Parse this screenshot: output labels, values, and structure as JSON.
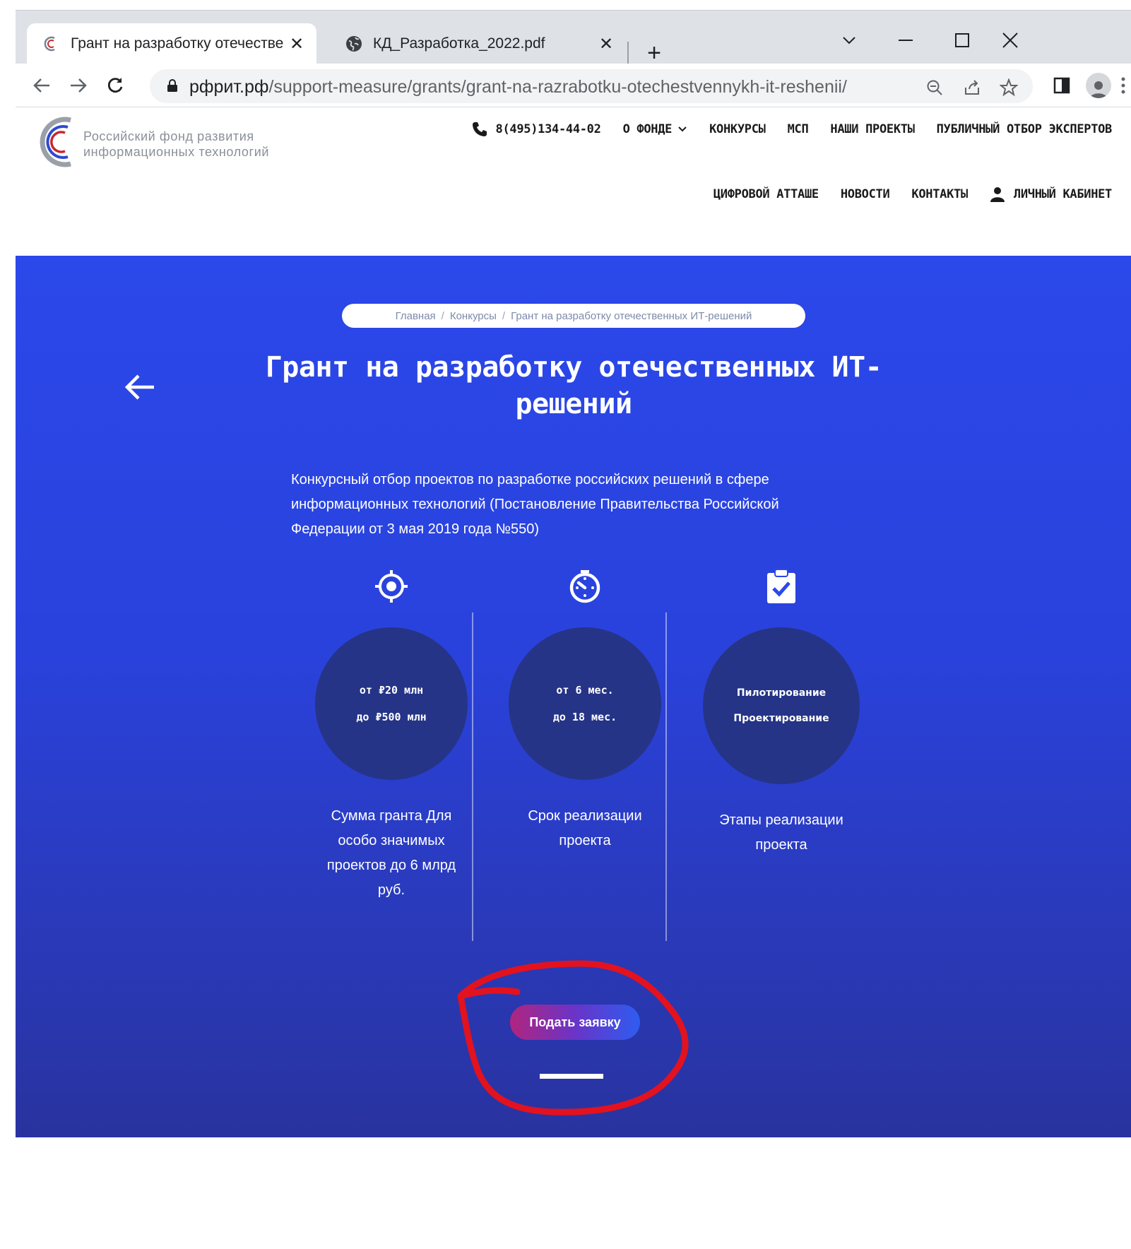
{
  "browser": {
    "tabs": [
      {
        "title": "Грант на разработку отечественных ИТ-решений",
        "active": true
      },
      {
        "title": "КД_Разработка_2022.pdf",
        "active": false
      }
    ],
    "url_host": "рфрит.рф",
    "url_path": "/support-measure/grants/grant-na-razrabotku-otechestvennykh-it-reshenii/"
  },
  "site": {
    "logo_line1": "Российский фонд развития",
    "logo_line2": "информационных технологий",
    "phone": "8(495)134-44-02",
    "nav_row1": [
      "О ФОНДЕ",
      "КОНКУРСЫ",
      "МСП",
      "НАШИ ПРОЕКТЫ",
      "ПУБЛИЧНЫЙ ОТБОР ЭКСПЕРТОВ"
    ],
    "nav_row2": [
      "ЦИФРОВОЙ АТТАШЕ",
      "НОВОСТИ",
      "КОНТАКТЫ",
      "ЛИЧНЫЙ КАБИНЕТ"
    ]
  },
  "hero": {
    "breadcrumb": [
      "Главная",
      "Конкурсы",
      "Грант на разработку отечественных ИТ-решений"
    ],
    "breadcrumb_sep": "/",
    "title_line1": "Грант на разработку отечественных ИТ-",
    "title_line2": "решений",
    "description": "Конкурсный отбор проектов по разработке российских решений в сфере информационных технологий (Постановление Правительства Российской Федерации от 3 мая 2019 года №550)",
    "stats": [
      {
        "icon": "target-icon",
        "line1": "от ₽20 млн",
        "line2": "до ₽500 млн",
        "caption": "Сумма гранта Для особо значимых проектов до 6 млрд руб."
      },
      {
        "icon": "timer-icon",
        "line1": "от 6 мес.",
        "line2": "до 18 мес.",
        "caption": "Срок реализации проекта"
      },
      {
        "icon": "clipboard-check-icon",
        "line1": "Пилотирование",
        "line2": "Проектирование",
        "caption": "Этапы реализации проекта"
      }
    ],
    "apply_label": "Подать заявку"
  },
  "colors": {
    "hero_top": "#2b48ea",
    "hero_bottom": "#29339f",
    "circle": "#253487",
    "annotation": "#e3121f"
  }
}
